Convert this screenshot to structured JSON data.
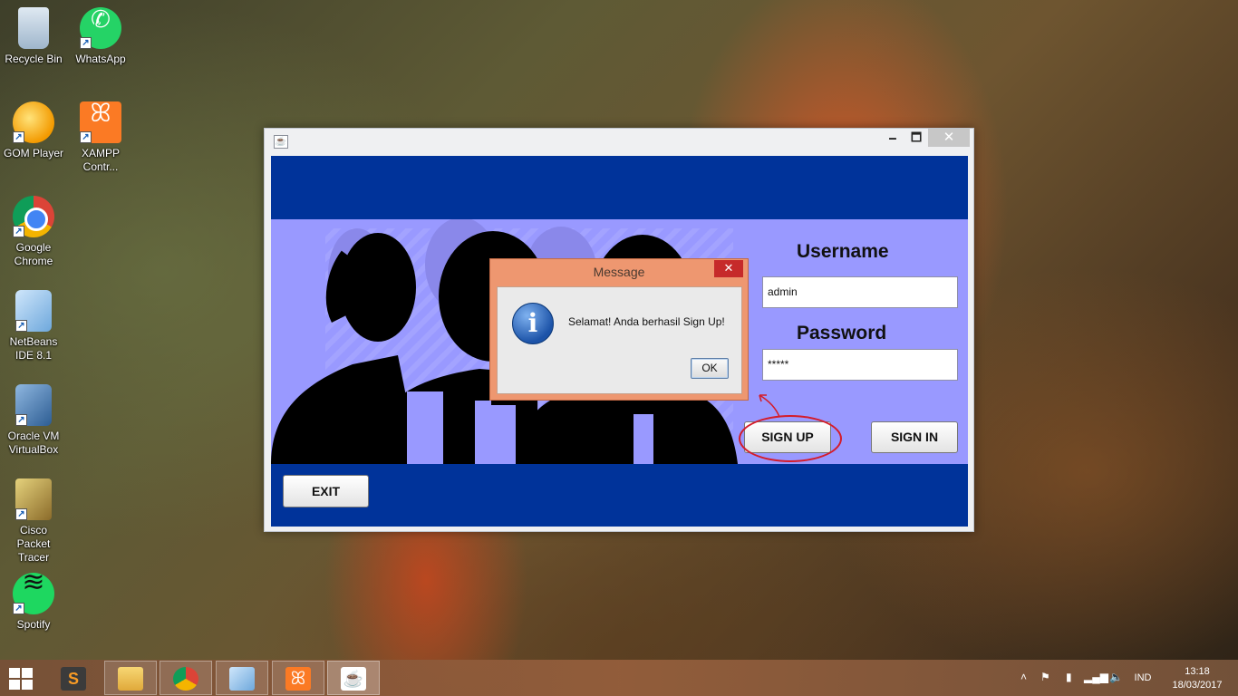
{
  "desktop": {
    "icons": [
      {
        "label": "Recycle Bin",
        "icon": "recycle-bin-icon"
      },
      {
        "label": "WhatsApp",
        "icon": "whatsapp-icon"
      },
      {
        "label": "GOM Player",
        "icon": "gom-player-icon"
      },
      {
        "label": "XAMPP Contr...",
        "icon": "xampp-icon"
      },
      {
        "label": "Google Chrome",
        "icon": "chrome-icon"
      },
      {
        "label": "NetBeans IDE 8.1",
        "icon": "netbeans-icon"
      },
      {
        "label": "Oracle VM VirtualBox",
        "icon": "virtualbox-icon"
      },
      {
        "label": "Cisco Packet Tracer",
        "icon": "cisco-packet-tracer-icon"
      },
      {
        "label": "Spotify",
        "icon": "spotify-icon"
      }
    ]
  },
  "window": {
    "min_glyph": "🗕",
    "max_glyph": "🗖",
    "close_glyph": "✕",
    "username_label": "Username",
    "username_value": "admin",
    "password_label": "Password",
    "password_value": "*****",
    "signup_label": "SIGN UP",
    "signin_label": "SIGN IN",
    "exit_label": "EXIT"
  },
  "dialog": {
    "title": "Message",
    "close_glyph": "✕",
    "message": "Selamat! Anda berhasil Sign Up!",
    "ok_label": "OK"
  },
  "taskbar": {
    "language": "IND",
    "time": "13:18",
    "date": "18/03/2017",
    "apps": [
      "sublime-text",
      "file-explorer",
      "chrome",
      "netbeans",
      "xampp",
      "java"
    ]
  }
}
